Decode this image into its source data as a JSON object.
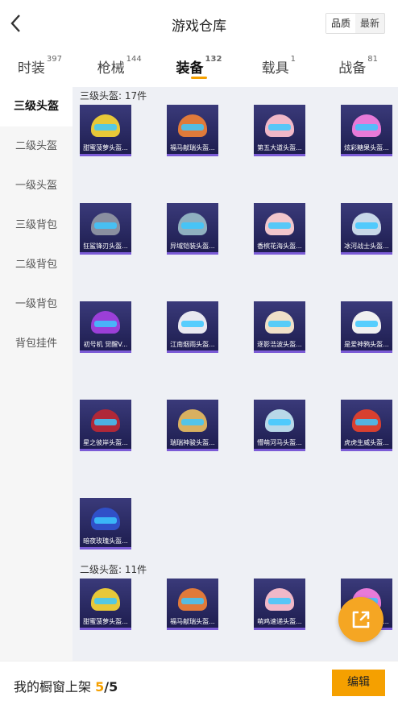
{
  "header": {
    "title": "游戏仓库",
    "sort_quality": "品质",
    "sort_latest": "最新"
  },
  "tabs": [
    {
      "label": "时装",
      "count": "397"
    },
    {
      "label": "枪械",
      "count": "144"
    },
    {
      "label": "装备",
      "count": "132"
    },
    {
      "label": "载具",
      "count": "1"
    },
    {
      "label": "战备",
      "count": "81"
    }
  ],
  "sidebar": {
    "items": [
      "三级头盔",
      "二级头盔",
      "一级头盔",
      "三级背包",
      "二级背包",
      "一级背包",
      "背包挂件"
    ]
  },
  "sections": [
    {
      "title": "三级头盔: 17件",
      "items": [
        "甜蜜菠萝头盔...",
        "福马献瑞头盔...",
        "第五大道头盔...",
        "炫彩糖果头盔...",
        "狂鲨锋刃头盔...",
        "异域铠装头盔...",
        "香槟花海头盔...",
        "冰河战士头盔...",
        "初号机 觉醒V...",
        "江南烟雨头盔...",
        "逐影浩波头盔...",
        "是爱神鸦头盔...",
        "星之彼岸头盔...",
        "瑞瑞神骏头盔...",
        "懵萌河马头盔...",
        "虎虎生威头盔...",
        "暗夜玫瑰头盔..."
      ]
    },
    {
      "title": "二级头盔: 11件",
      "items": [
        "甜蜜菠萝头盔...",
        "福马献瑞头盔...",
        "萌鸡速递头盔...",
        "幻彩电音头盔..."
      ]
    }
  ],
  "bottom": {
    "label": "我的橱窗上架",
    "shown": "5",
    "total": "/5",
    "edit_label": "编辑"
  },
  "colors": {
    "accent": "#f5a000",
    "card_bg": "#2c2b66"
  }
}
